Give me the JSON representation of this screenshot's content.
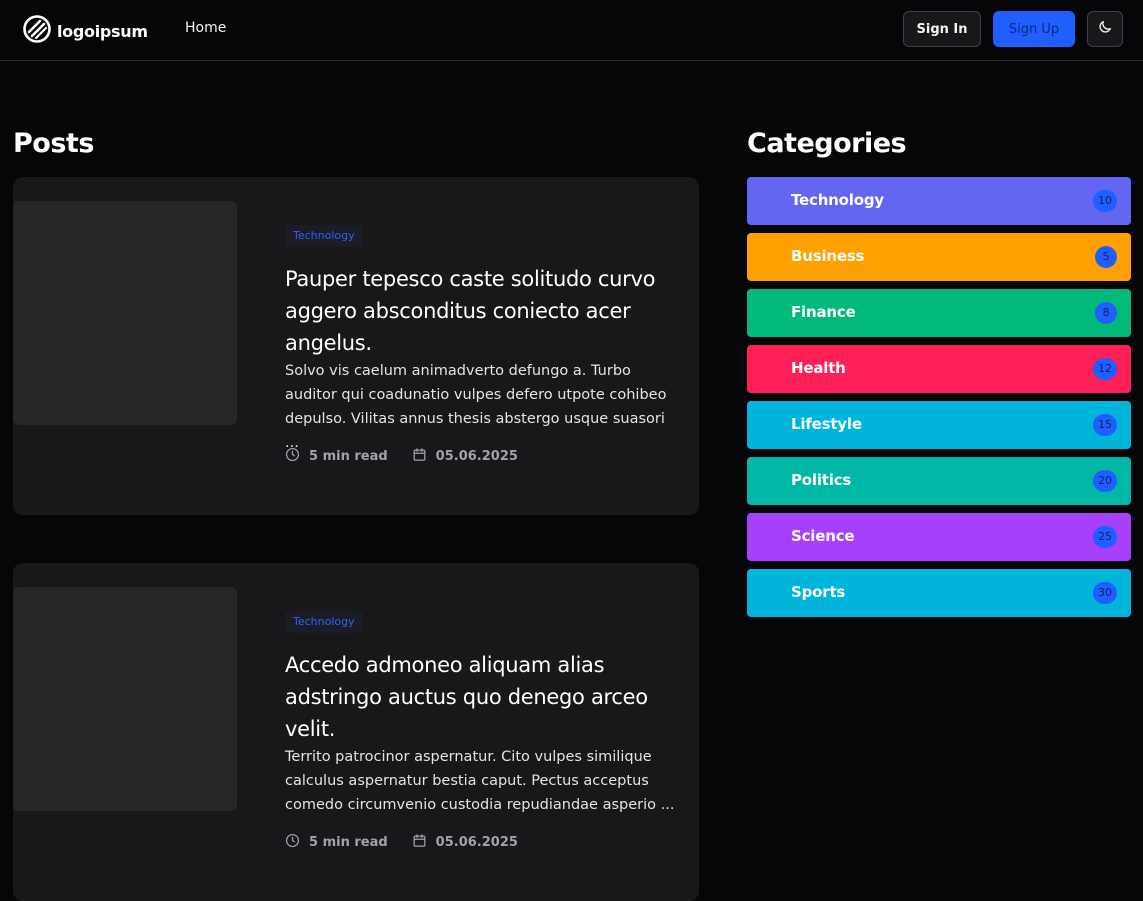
{
  "header": {
    "logo_text": "logoipsum",
    "nav_home": "Home",
    "sign_in": "Sign In",
    "sign_up": "Sign Up"
  },
  "posts": {
    "title": "Posts",
    "items": [
      {
        "category": "Technology",
        "title": "Pauper tepesco caste solitudo curvo aggero absconditus coniecto acer angelus.",
        "excerpt": "Solvo vis caelum animadverto defungo a. Turbo auditor qui coadunatio vulpes defero utpote cohibeo depulso. Vilitas annus thesis abstergo usque suasori ...",
        "read_time": "5 min read",
        "date": "05.06.2025"
      },
      {
        "category": "Technology",
        "title": "Accedo admoneo aliquam alias adstringo auctus quo denego arceo velit.",
        "excerpt": "Territo patrocinor aspernatur. Cito vulpes similique calculus aspernatur bestia caput. Pectus acceptus comedo circumvenio custodia repudiandae asperio ...",
        "read_time": "5 min read",
        "date": "05.06.2025"
      }
    ]
  },
  "categories": {
    "title": "Categories",
    "items": [
      {
        "label": "Technology",
        "count": "10",
        "color": "#6366f1"
      },
      {
        "label": "Business",
        "count": "5",
        "color": "#ff9f00"
      },
      {
        "label": "Finance",
        "count": "8",
        "color": "#00b97a"
      },
      {
        "label": "Health",
        "count": "12",
        "color": "#ff1f57"
      },
      {
        "label": "Lifestyle",
        "count": "15",
        "color": "#00b5db"
      },
      {
        "label": "Politics",
        "count": "20",
        "color": "#00b8a5"
      },
      {
        "label": "Science",
        "count": "25",
        "color": "#a640fb"
      },
      {
        "label": "Sports",
        "count": "30",
        "color": "#00b5db"
      }
    ]
  },
  "colors": {
    "accent": "#1f5eff",
    "background": "#060608",
    "card": "#18181b"
  },
  "icons": {
    "logo": "logo-icon",
    "theme": "moon-icon",
    "read_time": "clock-icon",
    "date": "calendar-icon"
  }
}
